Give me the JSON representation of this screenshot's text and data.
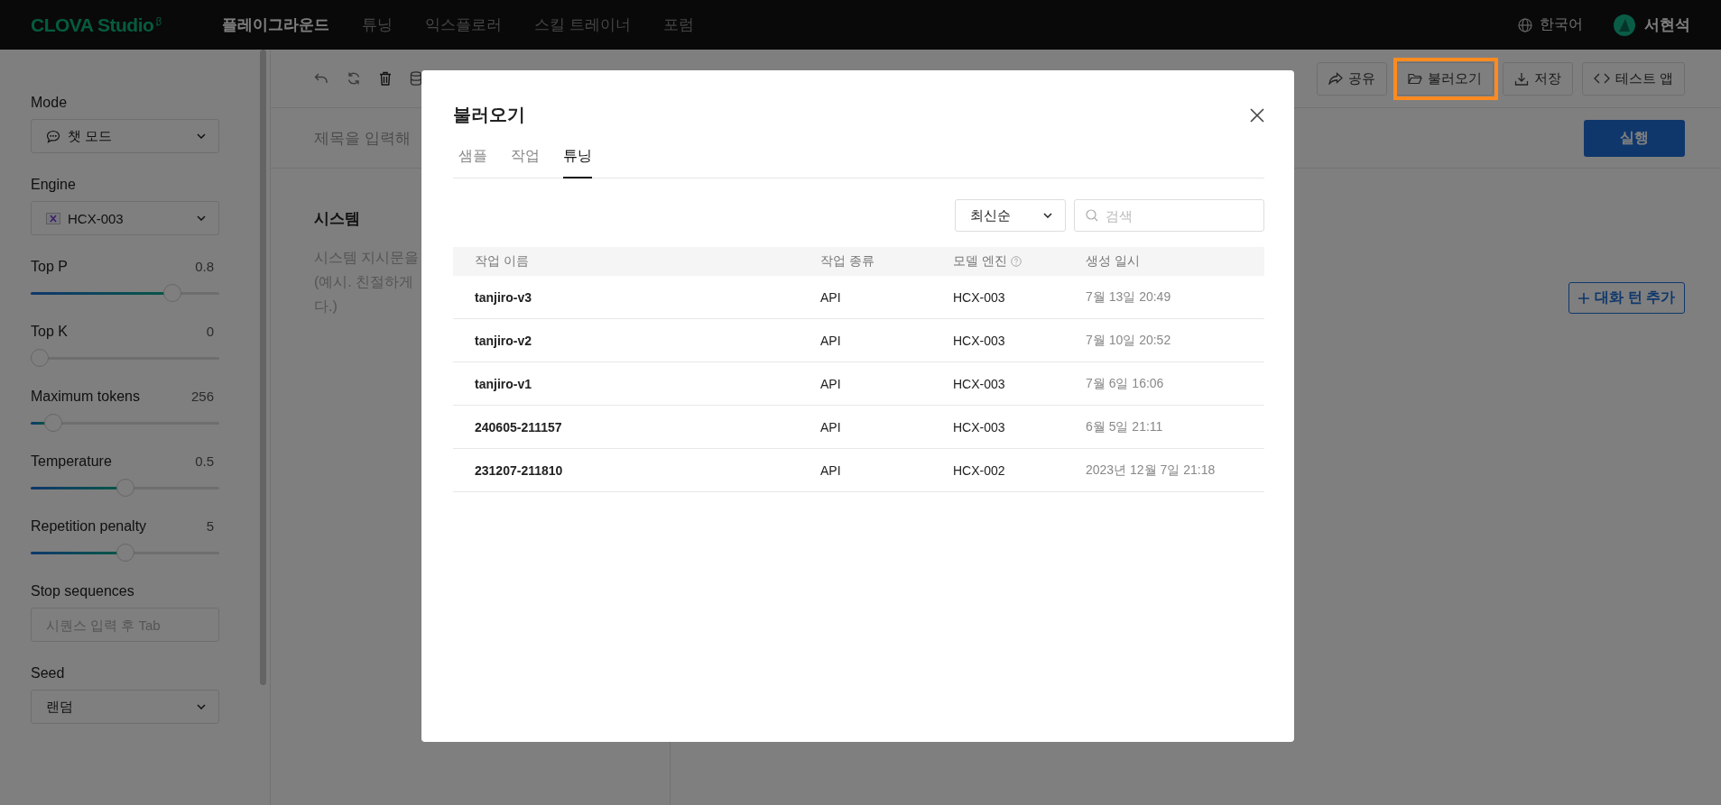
{
  "top_bar": {
    "logo": "CLOVA Studio",
    "nav": [
      {
        "label": "플레이그라운드",
        "selected": true
      },
      {
        "label": "튜닝",
        "selected": false
      },
      {
        "label": "익스플로러",
        "selected": false
      },
      {
        "label": "스킬 트레이너",
        "selected": false
      },
      {
        "label": "포럼",
        "selected": false
      }
    ],
    "language": "한국어",
    "user": "서현석"
  },
  "sidebar": {
    "mode": {
      "label": "Mode",
      "value": "챗 모드"
    },
    "engine": {
      "label": "Engine",
      "value": "HCX-003"
    },
    "sliders": [
      {
        "label": "Top P",
        "reading": "0.8",
        "level": 0.78
      },
      {
        "label": "Top K",
        "reading": "0",
        "level": 0
      },
      {
        "label": "Maximum tokens",
        "reading": "256",
        "level": 0.08
      },
      {
        "label": "Temperature",
        "reading": "0.5",
        "level": 0.5
      },
      {
        "label": "Repetition penalty",
        "reading": "5",
        "level": 0.5
      }
    ],
    "stop_sequences": {
      "label": "Stop sequences",
      "placeholder": "시퀀스 입력 후 Tab"
    },
    "seed": {
      "label": "Seed",
      "value": "랜덤"
    }
  },
  "toolbar": {
    "buttons": [
      {
        "kind": "share",
        "label": "공유",
        "highlighted": false
      },
      {
        "kind": "folder",
        "label": "불러오기",
        "highlighted": true
      },
      {
        "kind": "download",
        "label": "저장",
        "highlighted": false
      },
      {
        "kind": "code",
        "label": "테스트 앱",
        "highlighted": false
      }
    ]
  },
  "title_placeholder": "제목을 입력해",
  "run_button": "실행",
  "system": {
    "heading": "시스템",
    "lines": [
      "시스템 지시문을",
      "(예시. 친절하게",
      "다.)"
    ]
  },
  "add_turn_button": "대화 턴 추가",
  "dialog": {
    "title": "불러오기",
    "tabs": [
      {
        "label": "샘플",
        "selected": false
      },
      {
        "label": "작업",
        "selected": false
      },
      {
        "label": "튜닝",
        "selected": true
      }
    ],
    "sort": "최신순",
    "search_placeholder": "검색",
    "columns": [
      {
        "label": "작업 이름",
        "help": false
      },
      {
        "label": "작업 종류",
        "help": false
      },
      {
        "label": "모델 엔진",
        "help": true
      },
      {
        "label": "생성 일시",
        "help": false
      }
    ],
    "rows": [
      {
        "cells": [
          "tanjiro-v3",
          "API",
          "HCX-003",
          "7월 13일 20:49"
        ]
      },
      {
        "cells": [
          "tanjiro-v2",
          "API",
          "HCX-003",
          "7월 10일 20:52"
        ]
      },
      {
        "cells": [
          "tanjiro-v1",
          "API",
          "HCX-003",
          "7월 6일 16:06"
        ]
      },
      {
        "cells": [
          "240605-211157",
          "API",
          "HCX-003",
          "6월 5일 21:11"
        ]
      },
      {
        "cells": [
          "231207-211810",
          "API",
          "HCX-002",
          "2023년 12월 7일 21:18"
        ]
      }
    ]
  }
}
